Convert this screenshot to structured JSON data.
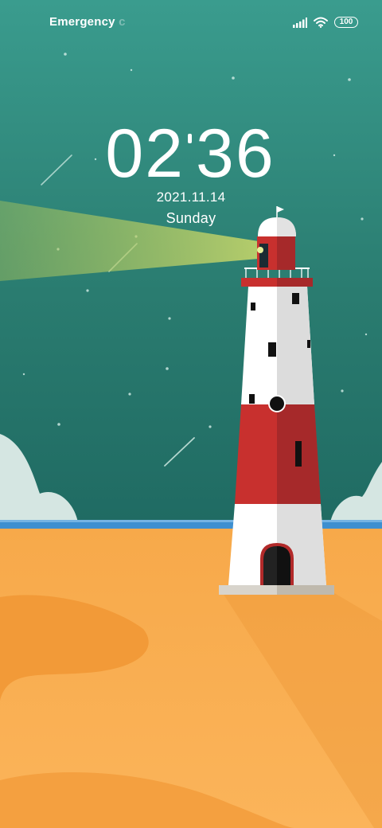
{
  "status_bar": {
    "carrier": "Emergency",
    "carrier_overflow": "c",
    "signal_icon": "signal-bars-icon",
    "wifi_icon": "wifi-icon",
    "battery": "100"
  },
  "lockscreen": {
    "hour": "02",
    "minute": "36",
    "date": "2021.11.14",
    "day": "Sunday"
  },
  "colors": {
    "sky": "#2a7c70",
    "sand": "#f5a545",
    "lighthouse_red": "#c8302e",
    "lighthouse_white": "#ffffff",
    "sea": "#3e8fd0"
  }
}
